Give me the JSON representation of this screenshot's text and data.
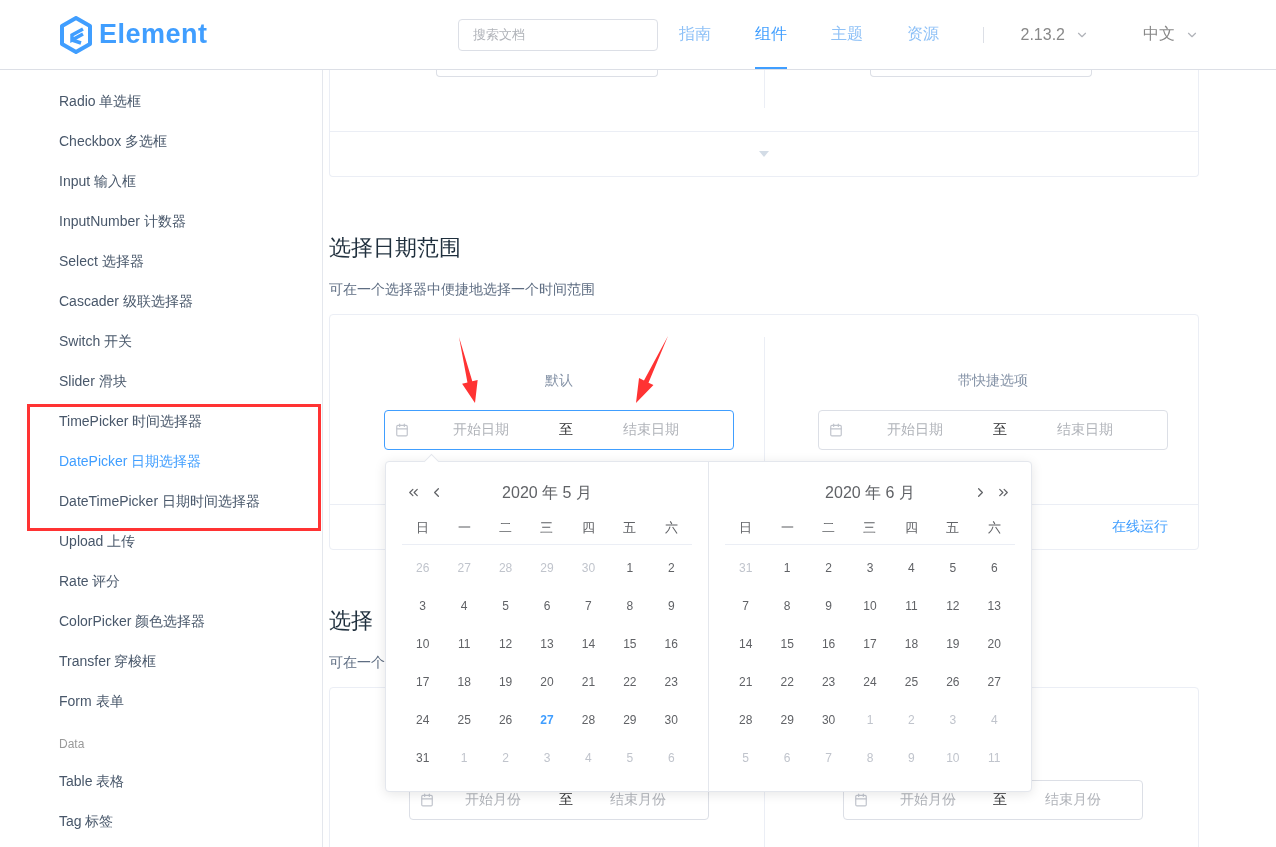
{
  "header": {
    "logo": "Element",
    "search": {
      "placeholder": "搜索文档"
    },
    "nav": [
      {
        "label": "指南",
        "selected": false
      },
      {
        "label": "组件",
        "selected": true
      },
      {
        "label": "主题",
        "selected": false
      },
      {
        "label": "资源",
        "selected": false
      }
    ],
    "version": "2.13.2",
    "language": "中文"
  },
  "sidebar": {
    "items": [
      {
        "kind": "link",
        "label": "Radio 单选框",
        "selected": false
      },
      {
        "kind": "link",
        "label": "Checkbox 多选框",
        "selected": false
      },
      {
        "kind": "link",
        "label": "Input 输入框",
        "selected": false
      },
      {
        "kind": "link",
        "label": "InputNumber 计数器",
        "selected": false
      },
      {
        "kind": "link",
        "label": "Select 选择器",
        "selected": false
      },
      {
        "kind": "link",
        "label": "Cascader 级联选择器",
        "selected": false
      },
      {
        "kind": "link",
        "label": "Switch 开关",
        "selected": false
      },
      {
        "kind": "link",
        "label": "Slider 滑块",
        "selected": false
      },
      {
        "kind": "link",
        "label": "TimePicker 时间选择器",
        "selected": false
      },
      {
        "kind": "link",
        "label": "DatePicker 日期选择器",
        "selected": true
      },
      {
        "kind": "link",
        "label": "DateTimePicker 日期时间选择器",
        "selected": false
      },
      {
        "kind": "link",
        "label": "Upload 上传",
        "selected": false
      },
      {
        "kind": "link",
        "label": "Rate 评分",
        "selected": false
      },
      {
        "kind": "link",
        "label": "ColorPicker 颜色选择器",
        "selected": false
      },
      {
        "kind": "link",
        "label": "Transfer 穿梭框",
        "selected": false
      },
      {
        "kind": "link",
        "label": "Form 表单",
        "selected": false
      },
      {
        "kind": "group",
        "label": "Data"
      },
      {
        "kind": "link",
        "label": "Table 表格",
        "selected": false
      },
      {
        "kind": "link",
        "label": "Tag 标签",
        "selected": false
      }
    ]
  },
  "sections": [
    {
      "title": "选择日期范围",
      "description": "可在一个选择器中便捷地选择一个时间范围",
      "demos": [
        {
          "label": "默认",
          "focused": true,
          "start_placeholder": "开始日期",
          "separator": "至",
          "end_placeholder": "结束日期"
        },
        {
          "label": "带快捷选项",
          "focused": false,
          "start_placeholder": "开始日期",
          "separator": "至",
          "end_placeholder": "结束日期"
        }
      ],
      "footer_link": "在线运行"
    },
    {
      "title": "选择",
      "description": "可在一个",
      "demos": [
        {
          "focused": false,
          "start_placeholder": "开始月份",
          "separator": "至",
          "end_placeholder": "结束月份"
        },
        {
          "focused": false,
          "start_placeholder": "开始月份",
          "separator": "至",
          "end_placeholder": "结束月份"
        }
      ]
    }
  ],
  "picker": {
    "panels": [
      {
        "title": "2020 年 5 月",
        "kind": "prev",
        "weekdays": [
          "日",
          "一",
          "二",
          "三",
          "四",
          "五",
          "六"
        ],
        "days": [
          {
            "text": "26",
            "kind": "other"
          },
          {
            "text": "27",
            "kind": "other"
          },
          {
            "text": "28",
            "kind": "other"
          },
          {
            "text": "29",
            "kind": "other"
          },
          {
            "text": "30",
            "kind": "other"
          },
          {
            "text": "1",
            "kind": "current"
          },
          {
            "text": "2",
            "kind": "current"
          },
          {
            "text": "3",
            "kind": "current"
          },
          {
            "text": "4",
            "kind": "current"
          },
          {
            "text": "5",
            "kind": "current"
          },
          {
            "text": "6",
            "kind": "current"
          },
          {
            "text": "7",
            "kind": "current"
          },
          {
            "text": "8",
            "kind": "current"
          },
          {
            "text": "9",
            "kind": "current"
          },
          {
            "text": "10",
            "kind": "current"
          },
          {
            "text": "11",
            "kind": "current"
          },
          {
            "text": "12",
            "kind": "current"
          },
          {
            "text": "13",
            "kind": "current"
          },
          {
            "text": "14",
            "kind": "current"
          },
          {
            "text": "15",
            "kind": "current"
          },
          {
            "text": "16",
            "kind": "current"
          },
          {
            "text": "17",
            "kind": "current"
          },
          {
            "text": "18",
            "kind": "current"
          },
          {
            "text": "19",
            "kind": "current"
          },
          {
            "text": "20",
            "kind": "current"
          },
          {
            "text": "21",
            "kind": "current"
          },
          {
            "text": "22",
            "kind": "current"
          },
          {
            "text": "23",
            "kind": "current"
          },
          {
            "text": "24",
            "kind": "current"
          },
          {
            "text": "25",
            "kind": "current"
          },
          {
            "text": "26",
            "kind": "current"
          },
          {
            "text": "27",
            "kind": "today"
          },
          {
            "text": "28",
            "kind": "current"
          },
          {
            "text": "29",
            "kind": "current"
          },
          {
            "text": "30",
            "kind": "current"
          },
          {
            "text": "31",
            "kind": "current"
          },
          {
            "text": "1",
            "kind": "other"
          },
          {
            "text": "2",
            "kind": "other"
          },
          {
            "text": "3",
            "kind": "other"
          },
          {
            "text": "4",
            "kind": "other"
          },
          {
            "text": "5",
            "kind": "other"
          },
          {
            "text": "6",
            "kind": "other"
          }
        ]
      },
      {
        "title": "2020 年 6 月",
        "kind": "next",
        "weekdays": [
          "日",
          "一",
          "二",
          "三",
          "四",
          "五",
          "六"
        ],
        "days": [
          {
            "text": "31",
            "kind": "other"
          },
          {
            "text": "1",
            "kind": "current"
          },
          {
            "text": "2",
            "kind": "current"
          },
          {
            "text": "3",
            "kind": "current"
          },
          {
            "text": "4",
            "kind": "current"
          },
          {
            "text": "5",
            "kind": "current"
          },
          {
            "text": "6",
            "kind": "current"
          },
          {
            "text": "7",
            "kind": "current"
          },
          {
            "text": "8",
            "kind": "current"
          },
          {
            "text": "9",
            "kind": "current"
          },
          {
            "text": "10",
            "kind": "current"
          },
          {
            "text": "11",
            "kind": "current"
          },
          {
            "text": "12",
            "kind": "current"
          },
          {
            "text": "13",
            "kind": "current"
          },
          {
            "text": "14",
            "kind": "current"
          },
          {
            "text": "15",
            "kind": "current"
          },
          {
            "text": "16",
            "kind": "current"
          },
          {
            "text": "17",
            "kind": "current"
          },
          {
            "text": "18",
            "kind": "current"
          },
          {
            "text": "19",
            "kind": "current"
          },
          {
            "text": "20",
            "kind": "current"
          },
          {
            "text": "21",
            "kind": "current"
          },
          {
            "text": "22",
            "kind": "current"
          },
          {
            "text": "23",
            "kind": "current"
          },
          {
            "text": "24",
            "kind": "current"
          },
          {
            "text": "25",
            "kind": "current"
          },
          {
            "text": "26",
            "kind": "current"
          },
          {
            "text": "27",
            "kind": "current"
          },
          {
            "text": "28",
            "kind": "current"
          },
          {
            "text": "29",
            "kind": "current"
          },
          {
            "text": "30",
            "kind": "current"
          },
          {
            "text": "1",
            "kind": "other"
          },
          {
            "text": "2",
            "kind": "other"
          },
          {
            "text": "3",
            "kind": "other"
          },
          {
            "text": "4",
            "kind": "other"
          },
          {
            "text": "5",
            "kind": "other"
          },
          {
            "text": "6",
            "kind": "other"
          },
          {
            "text": "7",
            "kind": "other"
          },
          {
            "text": "8",
            "kind": "other"
          },
          {
            "text": "9",
            "kind": "other"
          },
          {
            "text": "10",
            "kind": "other"
          },
          {
            "text": "11",
            "kind": "other"
          }
        ]
      }
    ]
  }
}
